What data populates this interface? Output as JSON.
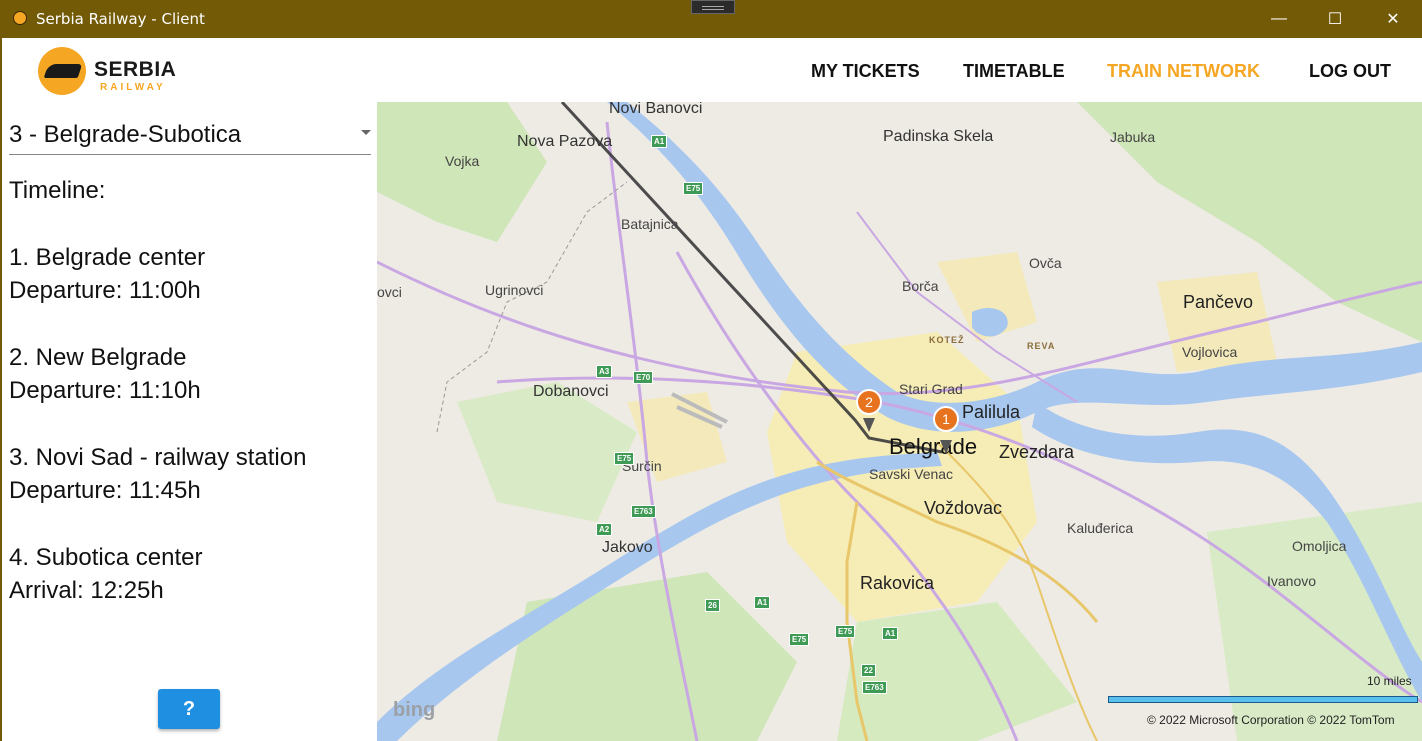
{
  "window": {
    "title": "Serbia Railway - Client",
    "minimize": "—",
    "maximize": "☐",
    "close": "✕"
  },
  "logo": {
    "line1": "SERBIA",
    "line2": "RAILWAY"
  },
  "nav": {
    "my_tickets": "MY TICKETS",
    "timetable": "TIMETABLE",
    "train_network": "TRAIN NETWORK",
    "log_out": "LOG OUT"
  },
  "route_select": {
    "value": "3 - Belgrade-Subotica"
  },
  "timeline": {
    "heading": "Timeline:",
    "stops": [
      {
        "name": "1.  Belgrade center",
        "time": "Departure: 11:00h"
      },
      {
        "name": "2.  New Belgrade",
        "time": "Departure: 11:10h"
      },
      {
        "name": "3.  Novi Sad - railway station",
        "time": "Departure: 11:45h"
      },
      {
        "name": "4.  Subotica center",
        "time": "Arrival: 12:25h"
      }
    ]
  },
  "help_button": "?",
  "map": {
    "places": [
      "Novi Banovci",
      "Nova Pazova",
      "Vojka",
      "Padinska Skela",
      "Jabuka",
      "Batajnica",
      "Ovča",
      "ovci",
      "Ugrinovci",
      "Borča",
      "Pančevo",
      "KOTEŽ",
      "REVA",
      "Vojlovica",
      "Stari Grad",
      "Dobanovci",
      "Palilula",
      "Belgrade",
      "Zvezdara",
      "Surčin",
      "Savski Venac",
      "Voždovac",
      "Kaluđerica",
      "Jakovo",
      "Omoljica",
      "Ivanovo",
      "Rakovica"
    ],
    "road_labels": [
      "A1",
      "E75",
      "A3",
      "E70",
      "E75",
      "E763",
      "A2",
      "26",
      "A1",
      "E75",
      "E75",
      "A1",
      "22",
      "E763"
    ],
    "pins": [
      "2",
      "1"
    ],
    "scale_label": "10 miles",
    "copyright": "© 2022 Microsoft Corporation    © 2022 TomTom",
    "provider": "bing",
    "colors": {
      "water": "#a8c7ef",
      "urban": "#f6e9a6",
      "green": "#bfe0a6",
      "route": "#3b3b3b",
      "pin": "#e8731f"
    }
  }
}
